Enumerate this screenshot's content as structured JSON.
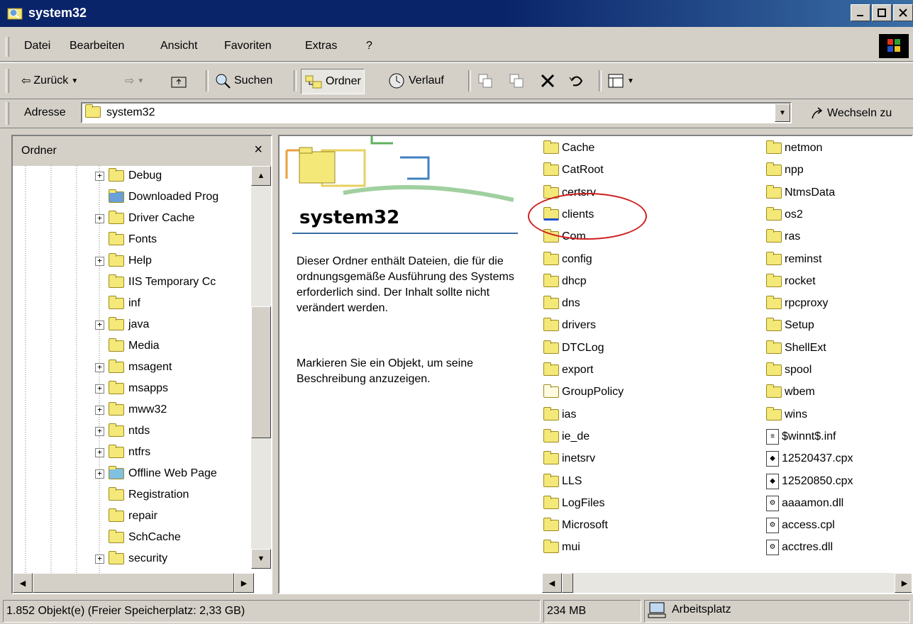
{
  "window": {
    "title": "system32"
  },
  "menu": [
    "Datei",
    "Bearbeiten",
    "Ansicht",
    "Favoriten",
    "Extras",
    "?"
  ],
  "toolbar": {
    "back": "Zurück",
    "search": "Suchen",
    "folders": "Ordner",
    "history": "Verlauf"
  },
  "address": {
    "label": "Adresse",
    "value": "system32",
    "go": "Wechseln zu"
  },
  "tree": {
    "header": "Ordner",
    "items": [
      {
        "label": "Debug",
        "expandable": true
      },
      {
        "label": "Downloaded Prog",
        "expandable": false,
        "icon": "ie-icon"
      },
      {
        "label": "Driver Cache",
        "expandable": true
      },
      {
        "label": "Fonts",
        "expandable": false
      },
      {
        "label": "Help",
        "expandable": true
      },
      {
        "label": "IIS Temporary Cc",
        "expandable": false
      },
      {
        "label": "inf",
        "expandable": false
      },
      {
        "label": "java",
        "expandable": true
      },
      {
        "label": "Media",
        "expandable": false
      },
      {
        "label": "msagent",
        "expandable": true
      },
      {
        "label": "msapps",
        "expandable": true
      },
      {
        "label": "mww32",
        "expandable": true
      },
      {
        "label": "ntds",
        "expandable": true
      },
      {
        "label": "ntfrs",
        "expandable": true
      },
      {
        "label": "Offline Web Page",
        "expandable": true,
        "icon": "offline-icon"
      },
      {
        "label": "Registration",
        "expandable": false
      },
      {
        "label": "repair",
        "expandable": false
      },
      {
        "label": "SchCache",
        "expandable": false
      },
      {
        "label": "security",
        "expandable": true
      }
    ]
  },
  "webview": {
    "title": "system32",
    "description": "Dieser Ordner enthält Dateien, die für die ordnungsgemäße Ausführung des Systems erforderlich sind. Der Inhalt sollte nicht verändert werden.",
    "hint": "Markieren Sie ein Objekt, um seine Beschreibung anzuzeigen."
  },
  "files": {
    "col1": [
      {
        "name": "Cache",
        "type": "folder"
      },
      {
        "name": "CatRoot",
        "type": "folder"
      },
      {
        "name": "certsrv",
        "type": "folder"
      },
      {
        "name": "clients",
        "type": "shared-folder"
      },
      {
        "name": "Com",
        "type": "folder"
      },
      {
        "name": "config",
        "type": "folder"
      },
      {
        "name": "dhcp",
        "type": "folder"
      },
      {
        "name": "dns",
        "type": "folder"
      },
      {
        "name": "drivers",
        "type": "folder"
      },
      {
        "name": "DTCLog",
        "type": "folder"
      },
      {
        "name": "export",
        "type": "folder"
      },
      {
        "name": "GroupPolicy",
        "type": "hidden-folder"
      },
      {
        "name": "ias",
        "type": "folder"
      },
      {
        "name": "ie_de",
        "type": "folder"
      },
      {
        "name": "inetsrv",
        "type": "folder"
      },
      {
        "name": "LLS",
        "type": "folder"
      },
      {
        "name": "LogFiles",
        "type": "folder"
      },
      {
        "name": "Microsoft",
        "type": "folder"
      },
      {
        "name": "mui",
        "type": "folder"
      }
    ],
    "col2": [
      {
        "name": "netmon",
        "type": "folder"
      },
      {
        "name": "npp",
        "type": "folder"
      },
      {
        "name": "NtmsData",
        "type": "folder"
      },
      {
        "name": "os2",
        "type": "folder"
      },
      {
        "name": "ras",
        "type": "folder"
      },
      {
        "name": "reminst",
        "type": "folder"
      },
      {
        "name": "rocket",
        "type": "folder"
      },
      {
        "name": "rpcproxy",
        "type": "folder"
      },
      {
        "name": "Setup",
        "type": "folder"
      },
      {
        "name": "ShellExt",
        "type": "folder"
      },
      {
        "name": "spool",
        "type": "folder"
      },
      {
        "name": "wbem",
        "type": "folder"
      },
      {
        "name": "wins",
        "type": "folder"
      },
      {
        "name": "$winnt$.inf",
        "type": "inf-file"
      },
      {
        "name": "12520437.cpx",
        "type": "cpx-file"
      },
      {
        "name": "12520850.cpx",
        "type": "cpx-file"
      },
      {
        "name": "aaaamon.dll",
        "type": "dll-file"
      },
      {
        "name": "access.cpl",
        "type": "dll-file"
      },
      {
        "name": "acctres.dll",
        "type": "dll-file"
      }
    ]
  },
  "status": {
    "objects": "1.852 Objekt(e) (Freier Speicherplatz: 2,33 GB)",
    "size": "234 MB",
    "zone": "Arbeitsplatz"
  },
  "colors": {
    "titlebar": "#0a246a",
    "highlight": "#d02020",
    "accent": "#3a6ea5"
  }
}
